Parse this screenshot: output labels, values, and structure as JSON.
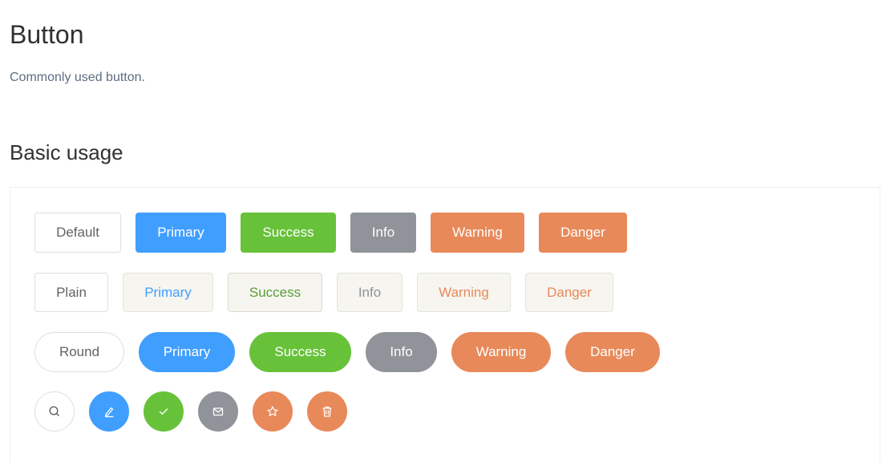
{
  "header": {
    "title": "Button",
    "description": "Commonly used button."
  },
  "section": {
    "title": "Basic usage"
  },
  "rows": {
    "basic": {
      "default": "Default",
      "primary": "Primary",
      "success": "Success",
      "info": "Info",
      "warning": "Warning",
      "danger": "Danger"
    },
    "plain": {
      "default": "Plain",
      "primary": "Primary",
      "success": "Success",
      "info": "Info",
      "warning": "Warning",
      "danger": "Danger"
    },
    "round": {
      "default": "Round",
      "primary": "Primary",
      "success": "Success",
      "info": "Info",
      "warning": "Warning",
      "danger": "Danger"
    },
    "circle_icons": [
      "search-icon",
      "edit-icon",
      "check-icon",
      "message-icon",
      "star-icon",
      "delete-icon"
    ]
  },
  "colors": {
    "primary": "#409eff",
    "success": "#67c23a",
    "info": "#909399",
    "warning": "#e8895a",
    "danger": "#e8895a"
  }
}
